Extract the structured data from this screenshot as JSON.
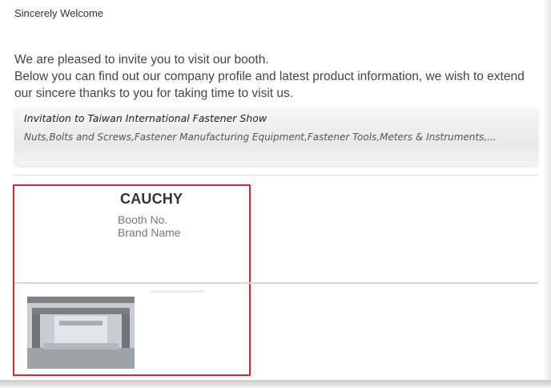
{
  "greeting": "Sincerely Welcome",
  "intro": {
    "line1": "We are pleased to invite you to visit our booth.",
    "line2": "Below you can find out our company profile and latest product information, we wish to extend our sincere thanks to you for taking time to visit us."
  },
  "banner": {
    "title": "Invitation to Taiwan International Fastener Show",
    "text": "Nuts,Bolts and Screws,Fastener Manufacturing Equipment,Fastener Tools,Meters & Instruments,..."
  },
  "exhibitor": {
    "company_name": "CAUCHY",
    "booth_no_label": "Booth No.",
    "brand_name_label": "Brand Name"
  },
  "colors": {
    "highlight": "#e0252b"
  },
  "icons": {
    "booth_photo": "booth-photo"
  }
}
